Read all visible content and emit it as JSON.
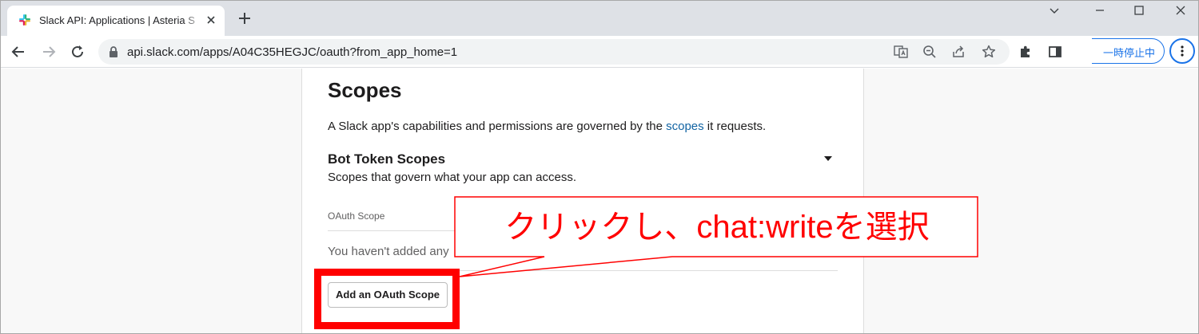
{
  "browser": {
    "tab_title": "Slack API: Applications | Asteria S",
    "url": "api.slack.com/apps/A04C35HEGJC/oauth?from_app_home=1",
    "paused_label": "一時停止中"
  },
  "page": {
    "heading": "Scopes",
    "description_before": "A Slack app's capabilities and permissions are governed by the ",
    "description_link": "scopes",
    "description_after": " it requests.",
    "bot_token_heading": "Bot Token Scopes",
    "bot_token_subtitle": "Scopes that govern what your app can access.",
    "column_header": "OAuth Scope",
    "empty_message": "You haven't added any",
    "add_button_label": "Add an OAuth Scope"
  },
  "annotation": {
    "callout_text": "クリックし、chat:writeを選択",
    "color": "#ff0000"
  },
  "colors": {
    "link": "#1264a3",
    "chrome_accent": "#1a73e8",
    "tab_strip": "#dee1e6"
  }
}
